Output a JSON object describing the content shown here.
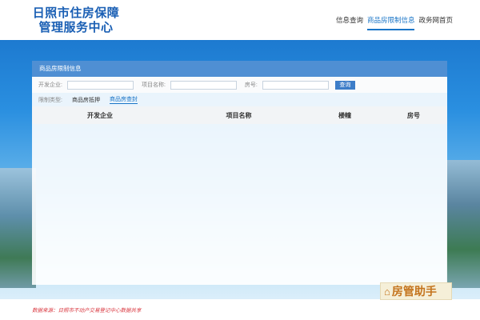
{
  "header": {
    "logo_line1": "日照市住房保障",
    "logo_line2": "管理服务中心",
    "nav": [
      {
        "label": "信息查询"
      },
      {
        "label": "商品房限制信息"
      },
      {
        "label": "政务网首页"
      }
    ],
    "active_nav": "商品房限制信息"
  },
  "panel": {
    "title": "商品房限制信息",
    "search": {
      "developer_label": "开发企业:",
      "developer_value": "",
      "project_label": "项目名称:",
      "project_value": "",
      "room_label": "房号:",
      "room_value": "",
      "query_button": "查询"
    },
    "restriction": {
      "label": "限制类型:",
      "options": [
        "商品房抵押",
        "商品房查封"
      ],
      "selected": "商品房查封"
    },
    "table": {
      "columns": [
        "开发企业",
        "项目名称",
        "楼幢",
        "房号"
      ],
      "rows": []
    }
  },
  "footer": {
    "source": "数据来源：日照市不动产交易登记中心数据共享"
  },
  "watermark": {
    "text": "房管助手"
  },
  "colors": {
    "brand": "#1a5fb4",
    "accent": "#1a75c7",
    "panel_header": "#4f8fd3",
    "source_text": "#d9363e"
  }
}
